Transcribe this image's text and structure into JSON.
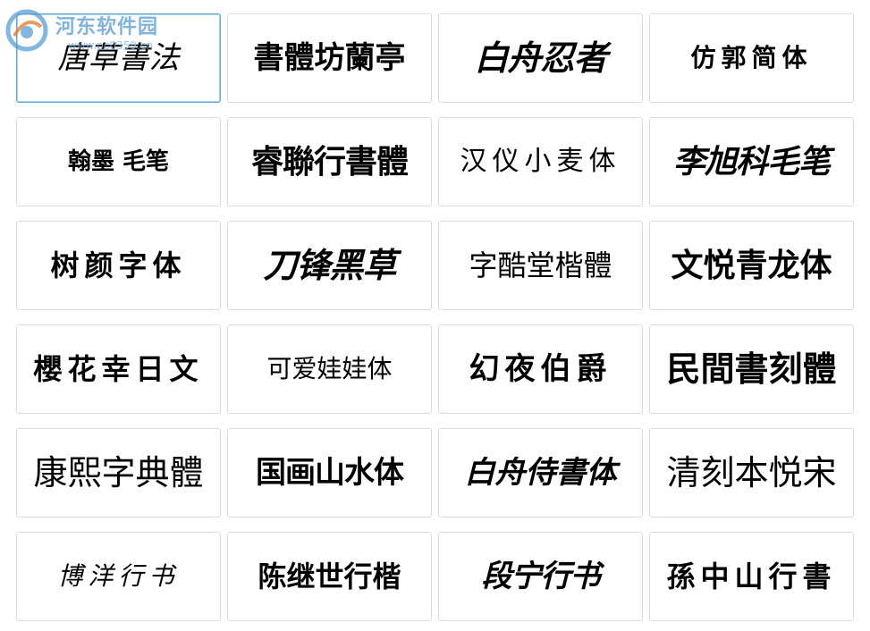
{
  "watermark": {
    "site_name": "河东软件园",
    "url": "www.pc0359.cn"
  },
  "fonts": [
    {
      "name": "唐草書法",
      "style": "s-thin s-italic",
      "size": 34
    },
    {
      "name": "書體坊蘭亭",
      "style": "s-bold",
      "size": 34
    },
    {
      "name": "白舟忍者",
      "style": "s-heavy s-italic",
      "size": 38
    },
    {
      "name": "仿郭简体",
      "style": "s-bold s-spaced",
      "size": 28
    },
    {
      "name": "翰墨 毛笔",
      "style": "s-bold",
      "size": 26
    },
    {
      "name": "睿聯行書體",
      "style": "s-heavy",
      "size": 36
    },
    {
      "name": "汉仪小麦体",
      "style": "s-thin s-sans s-spaced",
      "size": 30
    },
    {
      "name": "李旭科毛笔",
      "style": "s-heavy s-italic",
      "size": 36
    },
    {
      "name": "树颜字体",
      "style": "s-bold s-spaced",
      "size": 32
    },
    {
      "name": "刀锋黑草",
      "style": "s-heavy s-italic",
      "size": 38
    },
    {
      "name": "字酷堂楷體",
      "style": "s-thin",
      "size": 32
    },
    {
      "name": "文悦青龙体",
      "style": "s-bold",
      "size": 36
    },
    {
      "name": "櫻花幸日文",
      "style": "s-bold s-spaced",
      "size": 32
    },
    {
      "name": "可爱娃娃体",
      "style": "s-thin s-sans",
      "size": 28
    },
    {
      "name": "幻夜伯爵",
      "style": "s-bold s-spaced",
      "size": 34
    },
    {
      "name": "民間書刻體",
      "style": "s-bold",
      "size": 38
    },
    {
      "name": "康熙字典體",
      "style": "s-thin",
      "size": 38
    },
    {
      "name": "国画山水体",
      "style": "s-heavy",
      "size": 34
    },
    {
      "name": "白舟侍書体",
      "style": "s-bold s-italic",
      "size": 34
    },
    {
      "name": "清刻本悦宋",
      "style": "s-thin",
      "size": 38
    },
    {
      "name": "博洋行书",
      "style": "s-thin s-italic s-spaced",
      "size": 28
    },
    {
      "name": "陈继世行楷",
      "style": "s-bold",
      "size": 32
    },
    {
      "name": "段宁行书",
      "style": "s-heavy s-italic",
      "size": 34
    },
    {
      "name": "孫中山行書",
      "style": "s-bold s-spaced",
      "size": 32
    }
  ],
  "selected_index": 0
}
